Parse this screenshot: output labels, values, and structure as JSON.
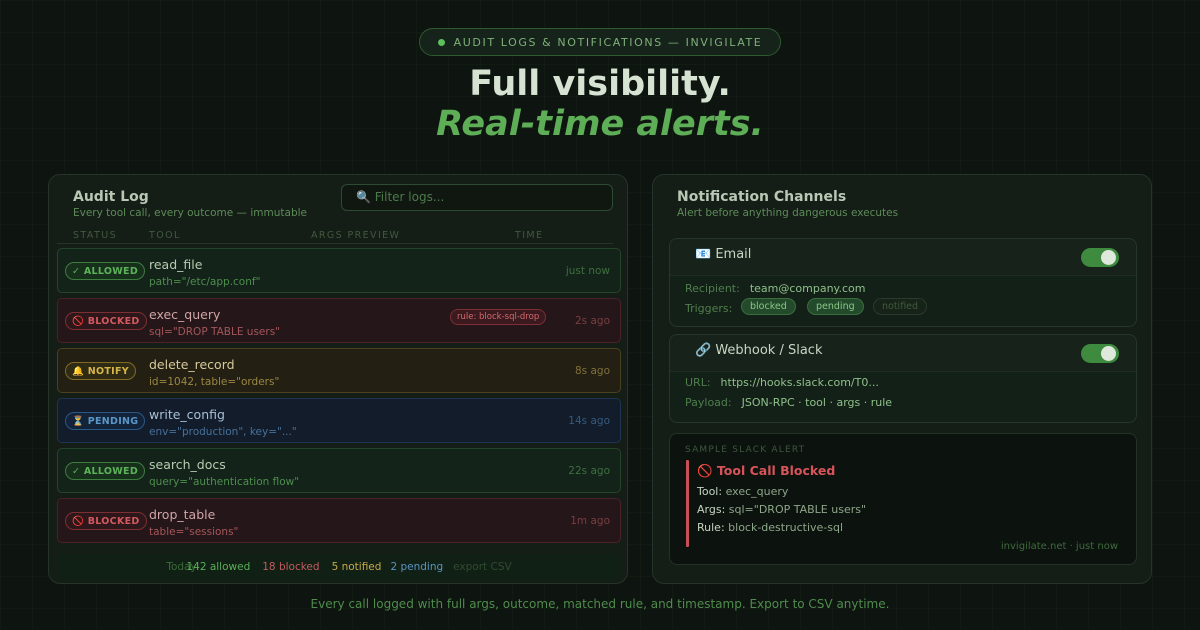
{
  "hero": {
    "badge": "AUDIT LOGS & NOTIFICATIONS — INVIGILATE",
    "title": "Full visibility.",
    "subtitle": "Real-time alerts."
  },
  "audit": {
    "title": "Audit Log",
    "subtitle": "Every tool call, every outcome — immutable",
    "filter_placeholder": "🔍 Filter logs...",
    "columns": [
      "STATUS",
      "TOOL",
      "ARGS PREVIEW",
      "TIME"
    ],
    "rows": [
      {
        "status": "allowed",
        "status_label": "✓ ALLOWED",
        "tool": "read_file",
        "args": "path=\"/etc/app.conf\"",
        "time": "just now",
        "rule": ""
      },
      {
        "status": "blocked",
        "status_label": "🚫 BLOCKED",
        "tool": "exec_query",
        "args": "sql=\"DROP TABLE users\"",
        "time": "2s ago",
        "rule": "rule: block-sql-drop"
      },
      {
        "status": "notify",
        "status_label": "🔔 NOTIFY",
        "tool": "delete_record",
        "args": "id=1042, table=\"orders\"",
        "time": "8s ago",
        "rule": ""
      },
      {
        "status": "pending",
        "status_label": "⏳ PENDING",
        "tool": "write_config",
        "args": "env=\"production\", key=\"...\"",
        "time": "14s ago",
        "rule": ""
      },
      {
        "status": "allowed",
        "status_label": "✓ ALLOWED",
        "tool": "search_docs",
        "args": "query=\"authentication flow\"",
        "time": "22s ago",
        "rule": ""
      },
      {
        "status": "blocked",
        "status_label": "🚫 BLOCKED",
        "tool": "drop_table",
        "args": "table=\"sessions\"",
        "time": "1m ago",
        "rule": ""
      }
    ],
    "footer": {
      "today": "Today:",
      "allowed": "142 allowed",
      "blocked": "18 blocked",
      "notified": "5 notified",
      "pending": "2 pending",
      "export": "export CSV"
    }
  },
  "notifications": {
    "title": "Notification Channels",
    "subtitle": "Alert before anything dangerous executes",
    "email": {
      "title": "📧 Email",
      "enabled": true,
      "recipient_label": "Recipient:",
      "recipient": "team@company.com",
      "triggers_label": "Triggers:",
      "triggers": [
        {
          "label": "blocked",
          "active": true
        },
        {
          "label": "pending",
          "active": true
        },
        {
          "label": "notified",
          "active": false
        }
      ]
    },
    "webhook": {
      "title": "🔗 Webhook / Slack",
      "enabled": true,
      "url_label": "URL:",
      "url": "https://hooks.slack.com/T0...",
      "payload_label": "Payload:",
      "payload": "JSON-RPC · tool · args · rule"
    },
    "sample": {
      "label": "SAMPLE SLACK ALERT",
      "title": "🚫 Tool Call Blocked",
      "tool_label": "Tool:",
      "tool": "exec_query",
      "args_label": "Args:",
      "args": "sql=\"DROP TABLE users\"",
      "rule_label": "Rule:",
      "rule": "block-destructive-sql",
      "footer": "invigilate.net · just now"
    }
  },
  "bottom_text": "Every call logged with full args, outcome, matched rule, and timestamp. Export to CSV anytime.",
  "colors": {
    "accent": "#5dae57",
    "blocked": "#d05a5e",
    "notify": "#d6b54a",
    "pending": "#5a97c9"
  }
}
